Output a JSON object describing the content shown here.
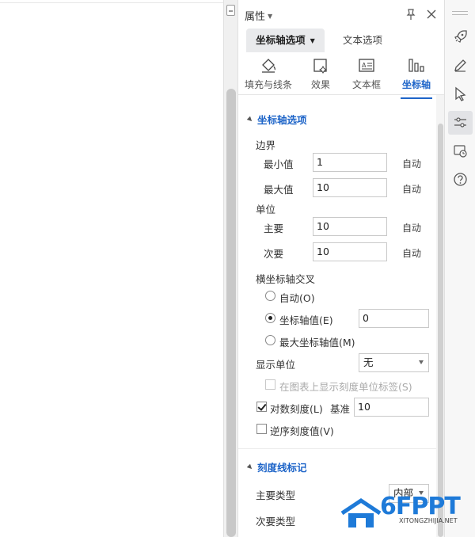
{
  "panel": {
    "title": "属性",
    "tabs": {
      "axis_options": "坐标轴选项",
      "text_options": "文本选项"
    },
    "icon_tabs": [
      {
        "label": "填充与线条",
        "icon": "paint-bucket-icon"
      },
      {
        "label": "效果",
        "icon": "effects-icon"
      },
      {
        "label": "文本框",
        "icon": "textbox-icon"
      },
      {
        "label": "坐标轴",
        "icon": "axis-chart-icon"
      }
    ]
  },
  "axis_options": {
    "section_title": "坐标轴选项",
    "bounds_label": "边界",
    "min_label": "最小值",
    "min_value": "1",
    "min_auto": "自动",
    "max_label": "最大值",
    "max_value": "10",
    "max_auto": "自动",
    "units_label": "单位",
    "major_label": "主要",
    "major_value": "10",
    "major_auto": "自动",
    "minor_label": "次要",
    "minor_value": "10",
    "minor_auto": "自动",
    "cross_label": "横坐标轴交叉",
    "cross_auto": "自动(O)",
    "cross_value_label": "坐标轴值(E)",
    "cross_value": "0",
    "cross_max": "最大坐标轴值(M)",
    "display_units_label": "显示单位",
    "display_units_value": "无",
    "show_units_label": "在图表上显示刻度单位标签(S)",
    "log_scale_label": "对数刻度(L)",
    "base_label": "基准",
    "base_value": "10",
    "reverse_label": "逆序刻度值(V)"
  },
  "tick_marks": {
    "section_title": "刻度线标记",
    "major_type_label": "主要类型",
    "major_type_value": "内部",
    "minor_type_label": "次要类型"
  },
  "watermark": {
    "text": "6FPPT",
    "sub": "XITONGZHIJIA.NET"
  },
  "colors": {
    "accent": "#1d64c8",
    "tab_bg": "#e9eaec"
  }
}
